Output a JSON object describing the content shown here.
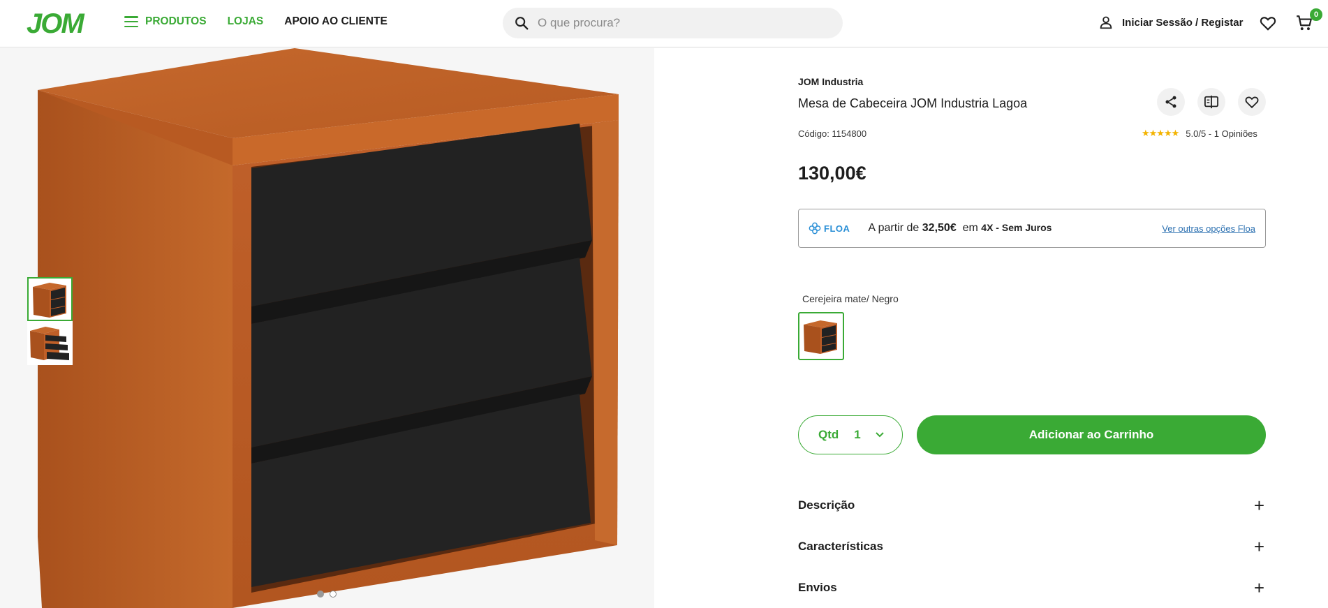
{
  "header": {
    "logo": "JOM",
    "nav": {
      "produtos": "PRODUTOS",
      "lojas": "LOJAS",
      "apoio": "APOIO AO CLIENTE"
    },
    "search_placeholder": "O que procura?",
    "login": "Iniciar Sessão / Registar",
    "cart_count": "0",
    "accent_color": "#3aaa35"
  },
  "gallery": {
    "thumbnails": [
      "thumbnail-front",
      "thumbnail-open-drawers"
    ],
    "active_index": 0,
    "dots": 2
  },
  "product": {
    "brand": "JOM Industria",
    "title": "Mesa de Cabeceira JOM Industria Lagoa",
    "code": "Código: 1154800",
    "rating_stars": "★★★★★",
    "rating_text": "5.0/5 - 1 Opiniões",
    "price": "130,00€",
    "actions": [
      "share-icon",
      "compare-icon",
      "heart-icon"
    ]
  },
  "financing": {
    "logo": "FLOA",
    "prefix": "A partir de",
    "amount": "32,50€",
    "mid": "em",
    "installments": "4X - Sem Juros",
    "link": "Ver outras opções Floa"
  },
  "variant": {
    "label": "Cerejeira mate/ Negro"
  },
  "purchase": {
    "qty_label": "Qtd",
    "qty_value": "1",
    "add_to_cart": "Adicionar ao Carrinho"
  },
  "accordion": [
    {
      "label": "Descrição"
    },
    {
      "label": "Características"
    },
    {
      "label": "Envios"
    }
  ]
}
